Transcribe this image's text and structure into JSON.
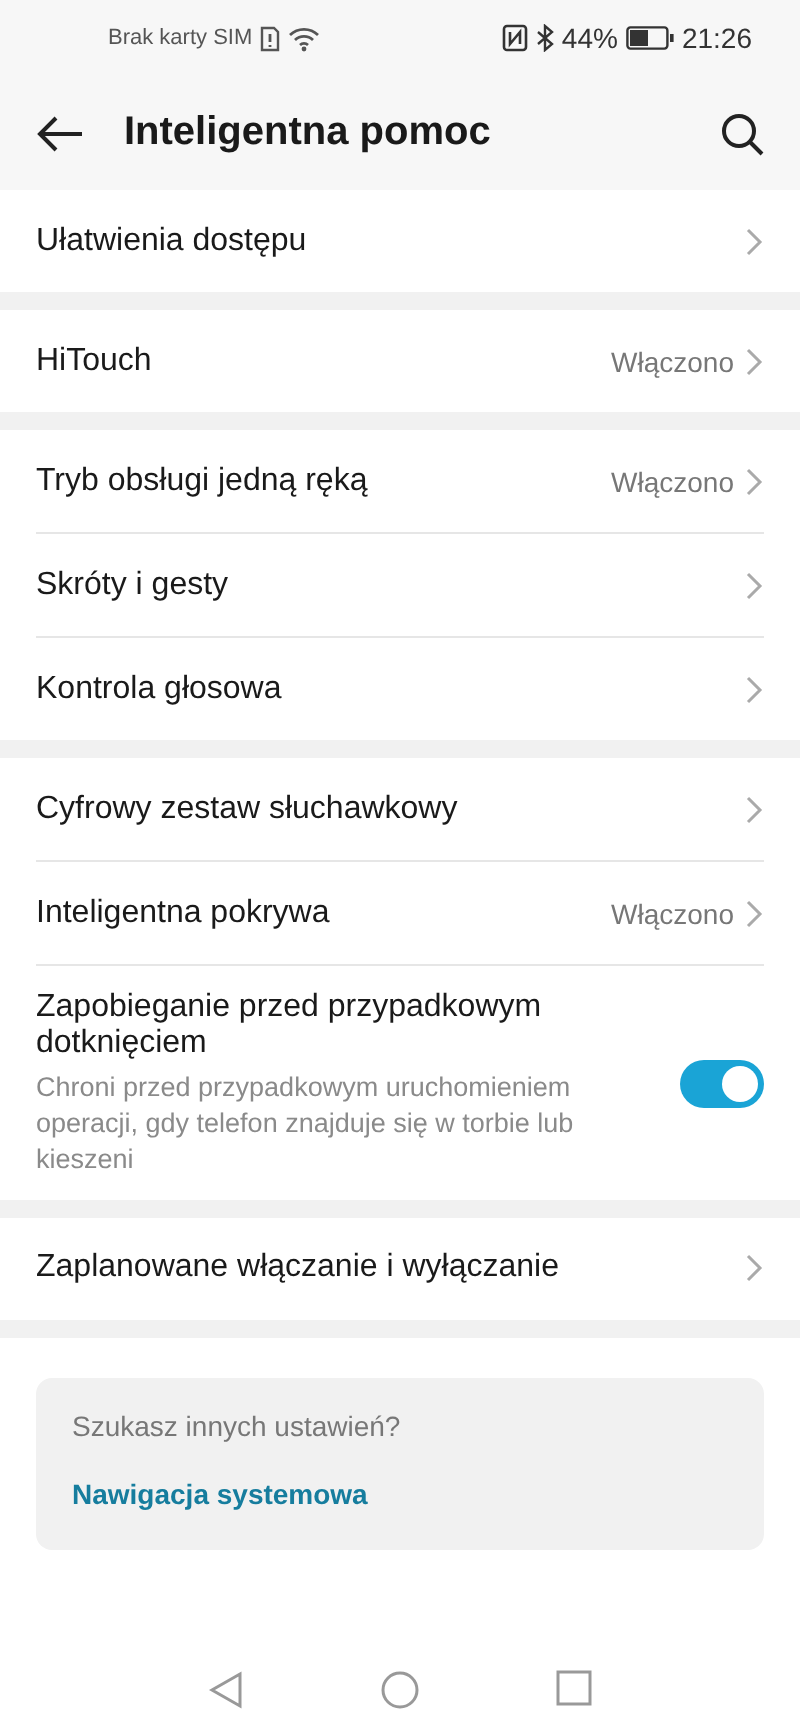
{
  "status_bar": {
    "carrier": "Brak karty SIM",
    "battery": "44%",
    "time": "21:26"
  },
  "header": {
    "title": "Inteligentna pomoc"
  },
  "groups": [
    {
      "items": [
        {
          "kind": "link",
          "label": "Ułatwienia dostępu"
        }
      ]
    },
    {
      "items": [
        {
          "kind": "link",
          "label": "HiTouch",
          "value": "Włączono"
        }
      ]
    },
    {
      "items": [
        {
          "kind": "link",
          "label": "Tryb obsługi jedną ręką",
          "value": "Włączono"
        },
        {
          "kind": "link",
          "label": "Skróty i gesty"
        },
        {
          "kind": "link",
          "label": "Kontrola głosowa"
        }
      ]
    },
    {
      "items": [
        {
          "kind": "link",
          "label": "Cyfrowy zestaw słuchawkowy"
        },
        {
          "kind": "link",
          "label": "Inteligentna pokrywa",
          "value": "Włączono"
        },
        {
          "kind": "toggle",
          "label": "Zapobieganie przed przypadkowym dotknięciem",
          "description": "Chroni przed przypadkowym uruchomieniem operacji, gdy telefon znajduje się w torbie lub kieszeni",
          "on": true
        }
      ]
    },
    {
      "items": [
        {
          "kind": "link",
          "label": "Zaplanowane włączanie i wyłączanie"
        }
      ]
    }
  ],
  "suggestion": {
    "question": "Szukasz innych ustawień?",
    "link": "Nawigacja systemowa"
  }
}
